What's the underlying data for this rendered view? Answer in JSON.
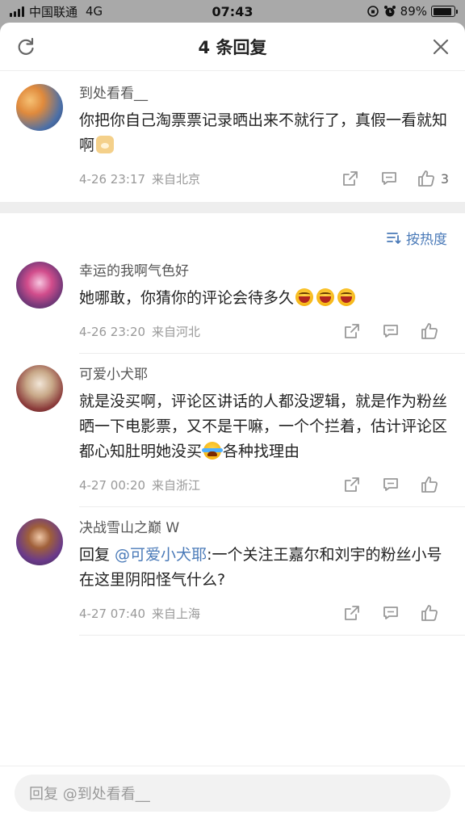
{
  "status_bar": {
    "carrier": "中国联通",
    "network": "4G",
    "time": "07:43",
    "battery": "89%",
    "battery_level": 0.89
  },
  "sheet": {
    "title": "4 条回复"
  },
  "main_comment": {
    "username": "到处看看__",
    "text": "你把你自己淘票票记录晒出来不就行了，真假一看就知啊",
    "emoji": "doge",
    "date": "4-26 23:17",
    "location": "来自北京",
    "like_count": "3"
  },
  "sort": {
    "label": "按热度"
  },
  "replies": [
    {
      "username": "幸运的我啊气色好",
      "text": "她哪敢，你猜你的评论会待多久",
      "emoji": "laugh x3",
      "date": "4-26 23:20",
      "location": "来自河北"
    },
    {
      "username": "可爱小犬耶",
      "text_before": "就是没买啊，评论区讲话的人都没逻辑，就是作为粉丝晒一下电影票，又不是干嘛，一个个拦着，估计评论区都心知肚明她没买",
      "text_after": "各种找理由",
      "emoji": "cry-laugh",
      "date": "4-27 00:20",
      "location": "来自浙江"
    },
    {
      "username": "决战雪山之巅 W",
      "reply_prefix": "回复 ",
      "reply_mention": "@可爱小犬耶",
      "text": ":一个关注王嘉尔和刘宇的粉丝小号在这里阴阳怪气什么?",
      "date": "4-27 07:40",
      "location": "来自上海"
    }
  ],
  "reply_box": {
    "placeholder": "回复 @到处看看__"
  },
  "colors": {
    "accent": "#4a7ab8",
    "overlay": "#a9a9a9"
  }
}
